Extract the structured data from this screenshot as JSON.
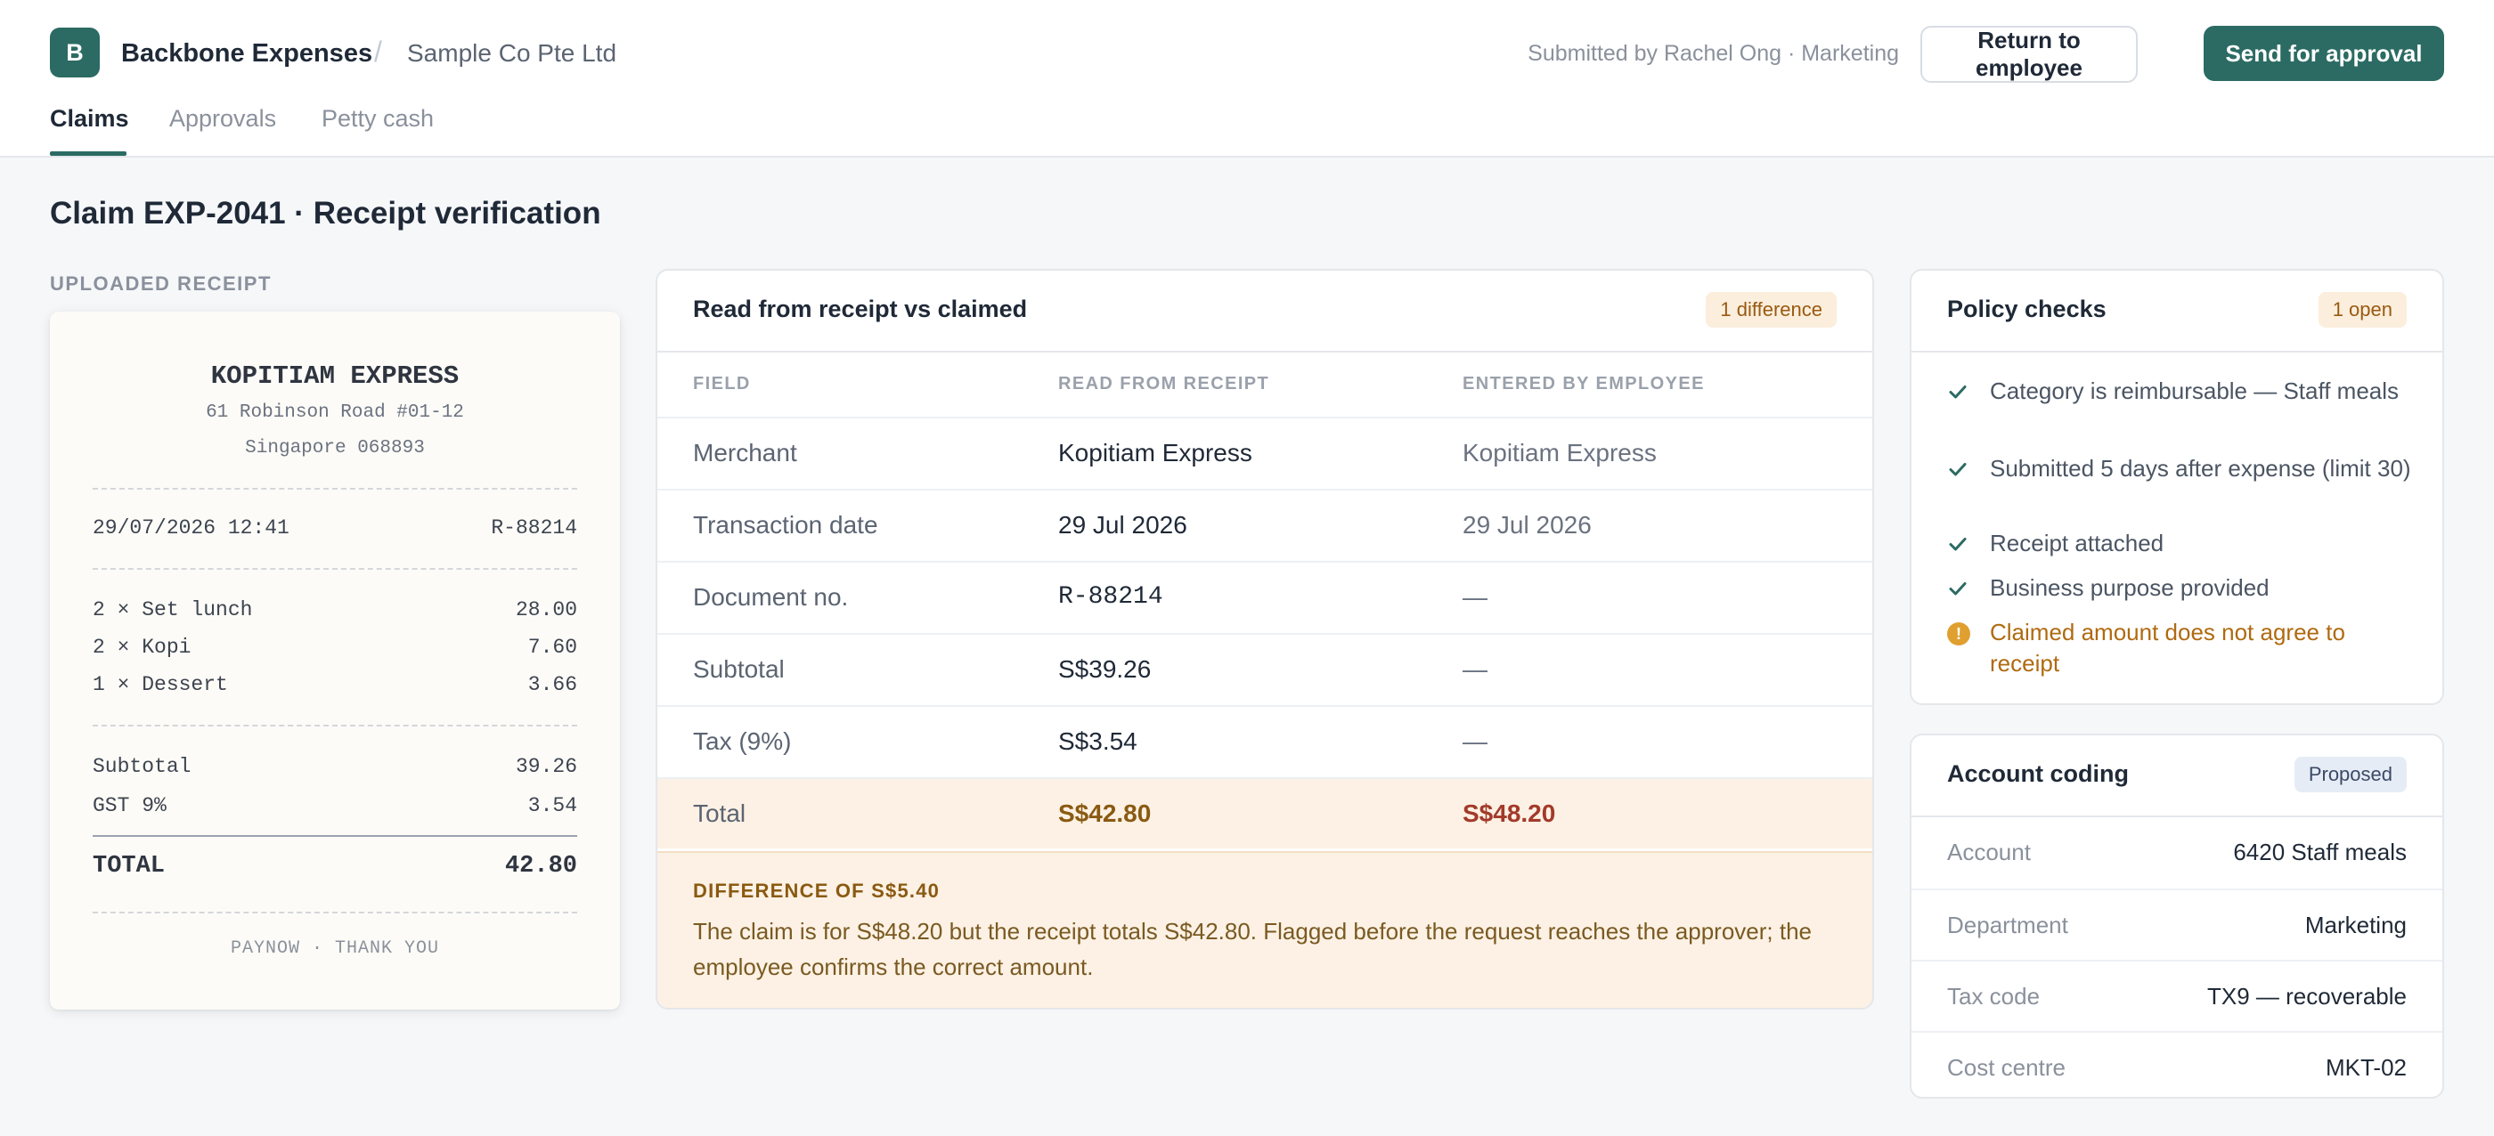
{
  "header": {
    "logo_letter": "B",
    "app_name": "Backbone Expenses",
    "separator": "/",
    "company": "Sample Co Pte Ltd",
    "submitted_by": "Submitted by Rachel Ong · Marketing",
    "return_label": "Return to employee",
    "send_label": "Send for approval",
    "tabs": [
      {
        "label": "Claims",
        "active": true
      },
      {
        "label": "Approvals",
        "active": false
      },
      {
        "label": "Petty cash",
        "active": false
      }
    ]
  },
  "page_title": "Claim EXP-2041 · Receipt verification",
  "receipt": {
    "section_label": "UPLOADED RECEIPT",
    "merchant": "KOPITIAM EXPRESS",
    "address_line1": "61 Robinson Road #01-12",
    "address_line2": "Singapore 068893",
    "datetime": "29/07/2026 12:41",
    "number": "R-88214",
    "items": [
      {
        "desc": "2 × Set lunch",
        "amount": "28.00"
      },
      {
        "desc": "2 × Kopi",
        "amount": "7.60"
      },
      {
        "desc": "1 × Dessert",
        "amount": "3.66"
      }
    ],
    "subtotal_label": "Subtotal",
    "subtotal": "39.26",
    "gst_label": "GST 9%",
    "gst": "3.54",
    "total_label": "TOTAL",
    "total": "42.80",
    "footer": "PAYNOW · THANK YOU"
  },
  "comparison": {
    "title": "Read from receipt vs claimed",
    "badge": "1 difference",
    "columns": [
      "FIELD",
      "READ FROM RECEIPT",
      "ENTERED BY EMPLOYEE"
    ],
    "rows": [
      {
        "field": "Merchant",
        "receipt": "Kopitiam Express",
        "employee": "Kopitiam Express"
      },
      {
        "field": "Transaction date",
        "receipt": "29 Jul 2026",
        "employee": "29 Jul 2026"
      },
      {
        "field": "Document no.",
        "receipt": "R-88214",
        "employee": "—"
      },
      {
        "field": "Subtotal",
        "receipt": "S$39.26",
        "employee": "—"
      },
      {
        "field": "Tax (9%)",
        "receipt": "S$3.54",
        "employee": "—"
      },
      {
        "field": "Total",
        "receipt": "S$42.80",
        "employee": "S$48.20"
      }
    ],
    "difference_label": "DIFFERENCE OF S$5.40",
    "difference_text": "The claim is for S$48.20 but the receipt totals S$42.80. Flagged before the request reaches the approver; the employee confirms the correct amount."
  },
  "policy": {
    "title": "Policy checks",
    "badge": "1 open",
    "checks": [
      {
        "text": "Category is reimbursable — Staff meals",
        "status": "pass"
      },
      {
        "text": "Submitted 5 days after expense (limit 30)",
        "status": "pass"
      },
      {
        "text": "Receipt attached",
        "status": "pass"
      },
      {
        "text": "Business purpose provided",
        "status": "pass"
      },
      {
        "text": "Claimed amount does not agree to receipt",
        "status": "warning"
      }
    ]
  },
  "coding": {
    "title": "Account coding",
    "badge": "Proposed",
    "rows": [
      {
        "key": "Account",
        "value": "6420 Staff meals"
      },
      {
        "key": "Department",
        "value": "Marketing"
      },
      {
        "key": "Tax code",
        "value": "TX9 — recoverable"
      },
      {
        "key": "Cost centre",
        "value": "MKT-02"
      }
    ]
  },
  "colors": {
    "brand": "#2b6b63",
    "warning": "#b06a10",
    "error": "#a33a2a",
    "success": "#2b6b63"
  }
}
